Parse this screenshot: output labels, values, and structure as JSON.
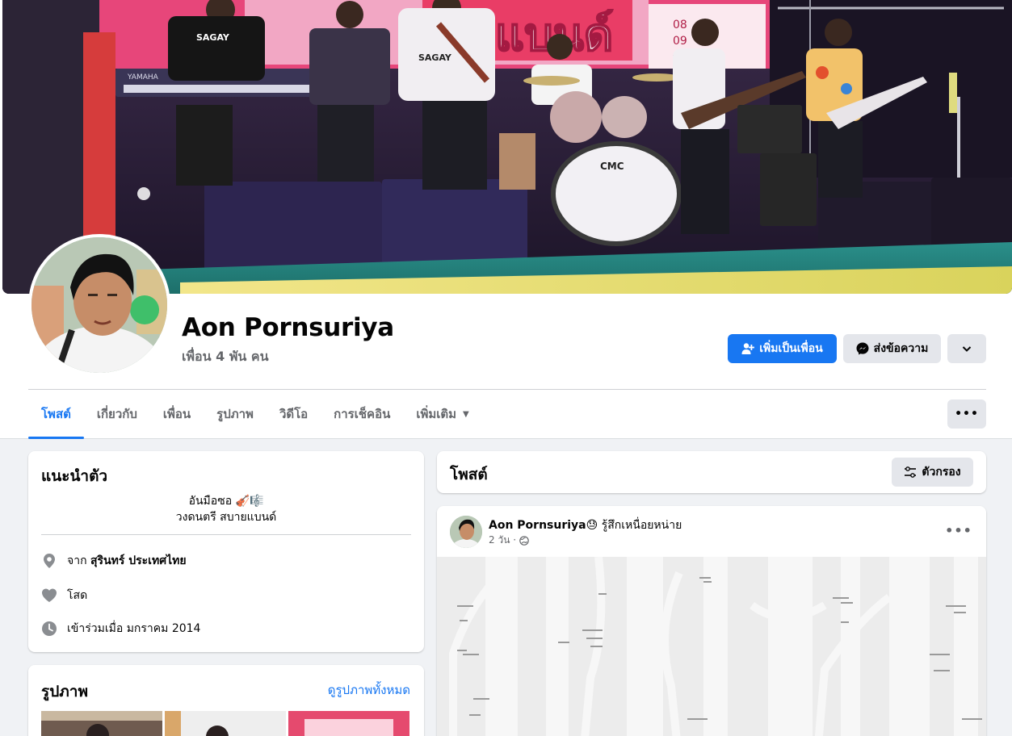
{
  "profile": {
    "name": "Aon Pornsuriya",
    "friends": "เพื่อน 4 พัน คน",
    "add_friend_label": "เพิ่มเป็นเพื่อน",
    "message_label": "ส่งข้อความ"
  },
  "tabs": [
    {
      "label": "โพสต์",
      "active": true
    },
    {
      "label": "เกี่ยวกับ"
    },
    {
      "label": "เพื่อน"
    },
    {
      "label": "รูปภาพ"
    },
    {
      "label": "วิดีโอ"
    },
    {
      "label": "การเช็คอิน"
    },
    {
      "label": "เพิ่มเติม"
    }
  ],
  "intro": {
    "title": "แนะนำตัว",
    "bio_line1": "อันมือซอ 🎻🎼",
    "bio_line2": "วงดนตรี สบายแบนด์",
    "location_prefix": "จาก",
    "location": "สุรินทร์ ประเทศไทย",
    "relationship": "โสด",
    "joined": "เข้าร่วมเมื่อ มกราคม 2014"
  },
  "photos": {
    "title": "รูปภาพ",
    "see_all": "ดูรูปภาพทั้งหมด"
  },
  "posts_section": {
    "title": "โพสต์",
    "filter_label": "ตัวกรอง"
  },
  "post": {
    "author": "Aon Pornsuriya",
    "feeling_emoji": "😓",
    "feeling": "รู้สึกเหนื่อยหน่าย",
    "time": "2 วัน ·"
  },
  "cover_banner": {
    "brand_text": "SAGAY",
    "keyboard_text": "YAMAHA",
    "drum_text": "CMC"
  },
  "colors": {
    "accent": "#1877f2",
    "secondary_button": "#e4e6eb",
    "page_background": "#f0f2f5"
  }
}
